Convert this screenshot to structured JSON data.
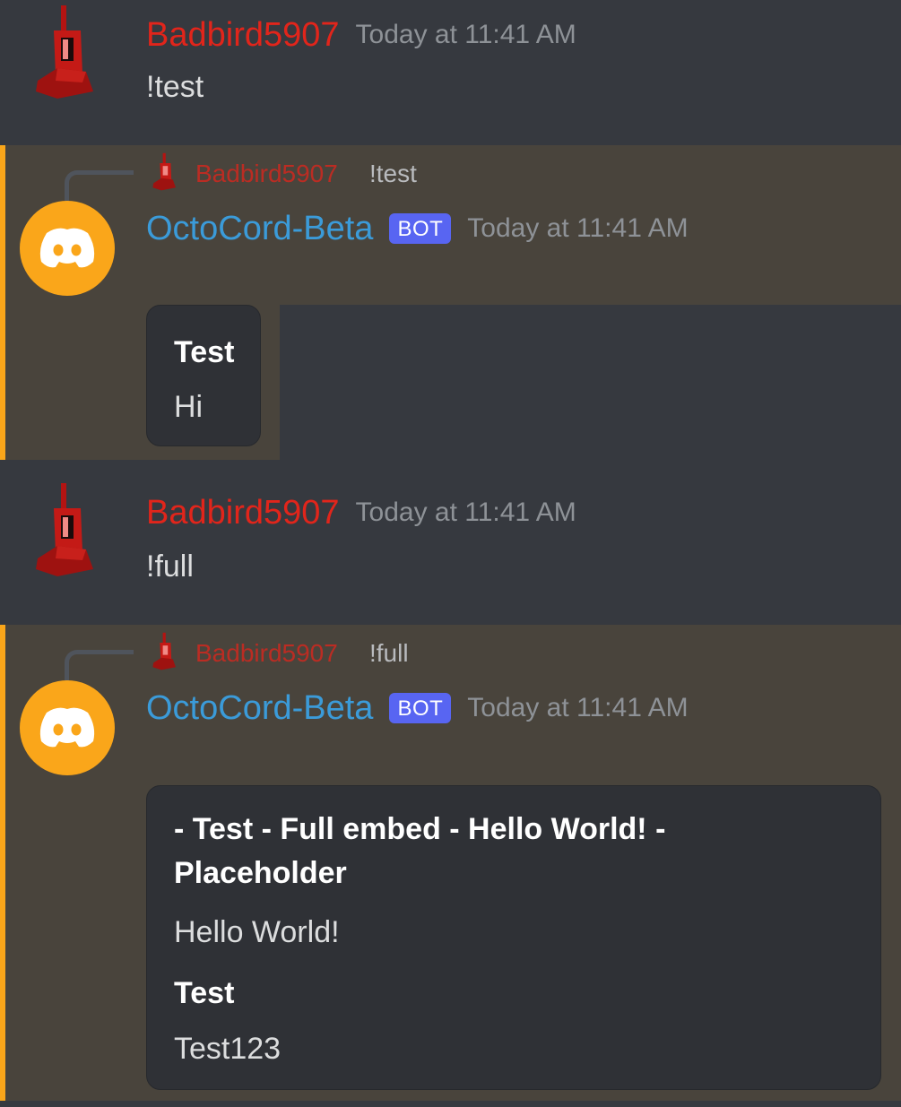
{
  "colors": {
    "username_red": "#e1251b",
    "bot_name_blue": "#3b9bd9",
    "bot_tag_bg": "#5865f2",
    "mention_accent": "#faa61a",
    "bot_avatar_bg": "#faa61a"
  },
  "messages": [
    {
      "author": "Badbird5907",
      "timestamp": "Today at 11:41 AM",
      "text": "!test",
      "avatar_icon": "red-robot-avatar-icon"
    },
    {
      "reply": {
        "author": "Badbird5907",
        "text": "!test"
      },
      "author": "OctoCord-Beta",
      "tag": "BOT",
      "timestamp": "Today at 11:41 AM",
      "avatar_icon": "discord-logo-icon",
      "embed": {
        "title": "Test",
        "description": "Hi"
      }
    },
    {
      "author": "Badbird5907",
      "timestamp": "Today at 11:41 AM",
      "text": "!full",
      "avatar_icon": "red-robot-avatar-icon"
    },
    {
      "reply": {
        "author": "Badbird5907",
        "text": "!full"
      },
      "author": "OctoCord-Beta",
      "tag": "BOT",
      "timestamp": "Today at 11:41 AM",
      "avatar_icon": "discord-logo-icon",
      "embed": {
        "title": "- Test - Full embed - Hello World! - Placeholder",
        "description": "Hello World!",
        "field_name": "Test",
        "field_value": "Test123"
      }
    }
  ]
}
